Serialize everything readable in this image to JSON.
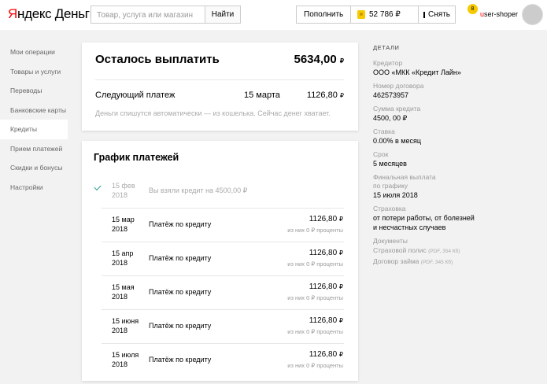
{
  "header": {
    "logo_red": "Я",
    "logo_rest": "ндекс Деньги",
    "search_placeholder": "Товар, услуга или магазин",
    "find_label": "Найти",
    "topup_label": "Пополнить",
    "balance": "52 786 ₽",
    "badge_count": "8",
    "withdraw_label": "Снять",
    "username_first": "u",
    "username_rest": "ser-shoper"
  },
  "sidebar": {
    "items": [
      {
        "label": "Мои операции"
      },
      {
        "label": "Товары и услуги"
      },
      {
        "label": "Переводы"
      },
      {
        "label": "Банковские карты"
      },
      {
        "label": "Кредиты"
      },
      {
        "label": "Прием платежей"
      },
      {
        "label": "Скидки и бонусы"
      },
      {
        "label": "Настройки"
      }
    ],
    "active_index": 4
  },
  "summary": {
    "title": "Осталось выплатить",
    "amount": "5634,00",
    "currency": "₽",
    "next_label": "Следующий платеж",
    "next_date": "15 марта",
    "next_amount": "1126,80",
    "note": "Деньги спишутся автоматически — из кошелька. Сейчас денег хватает."
  },
  "schedule": {
    "title": "График платежей",
    "currency": "₽",
    "rows": [
      {
        "date_line1": "15 фев",
        "date_line2": "2018",
        "label": "Вы взяли кредит на 4500,00 ₽",
        "amount": "",
        "sub": ""
      },
      {
        "date_line1": "15 мар",
        "date_line2": "2018",
        "label": "Платёж по кредиту",
        "amount": "1126,80",
        "sub": "из них 0 ₽ проценты"
      },
      {
        "date_line1": "15 апр",
        "date_line2": "2018",
        "label": "Платёж по кредиту",
        "amount": "1126,80",
        "sub": "из них 0 ₽ проценты"
      },
      {
        "date_line1": "15 мая",
        "date_line2": "2018",
        "label": "Платёж по кредиту",
        "amount": "1126,80",
        "sub": "из них 0 ₽ проценты"
      },
      {
        "date_line1": "15 июня",
        "date_line2": "2018",
        "label": "Платёж по кредиту",
        "amount": "1126,80",
        "sub": "из них 0 ₽ проценты"
      },
      {
        "date_line1": "15 июля",
        "date_line2": "2018",
        "label": "Платёж по кредиту",
        "amount": "1126,80",
        "sub": "из них 0 ₽ проценты"
      }
    ]
  },
  "details": {
    "heading": "ДЕТАЛИ",
    "creditor_label": "Кредитор",
    "creditor_value": "ООО «МКК «Кредит Лайн»",
    "contract_label": "Номер договора",
    "contract_value": "462573957",
    "sum_label": "Сумма кредита",
    "sum_value": "4500, 00 ₽",
    "rate_label": "Ставка",
    "rate_value": "0.00% в месяц",
    "term_label": "Срок",
    "term_value": "5 месяцев",
    "final_label_1": "Финальная выплата",
    "final_label_2": "по графику",
    "final_value": "15 июля 2018",
    "insurance_label": "Страховка",
    "insurance_value_1": "от потери работы, от болезней",
    "insurance_value_2": "и несчастных случаев",
    "docs_label": "Документы",
    "doc1_name": "Страховой полис",
    "doc1_size": "(PDF, 354 Кб)",
    "doc2_name": "Договор займа",
    "doc2_size": "(PDF, 345 Кб)"
  }
}
